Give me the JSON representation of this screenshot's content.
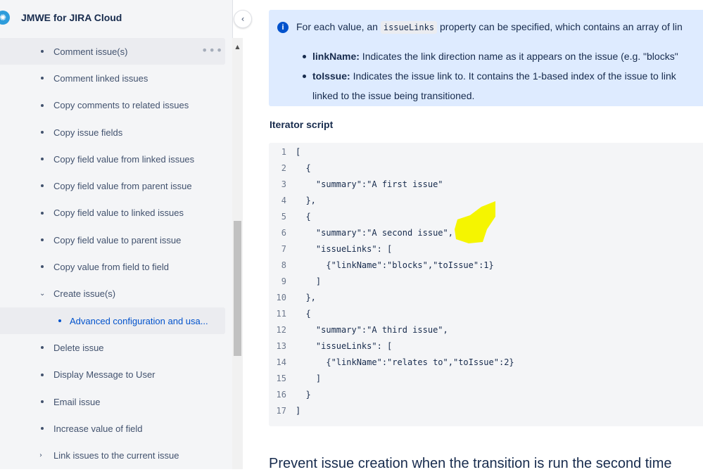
{
  "sidebar": {
    "title": "JMWE for JIRA Cloud",
    "collapse_icon": "‹",
    "more_icon": "•••",
    "items": [
      {
        "label": "Comment issue(s)",
        "type": "bullet",
        "highlight": true,
        "more": true
      },
      {
        "label": "Comment linked issues",
        "type": "bullet"
      },
      {
        "label": "Copy comments to related issues",
        "type": "bullet"
      },
      {
        "label": "Copy issue fields",
        "type": "bullet"
      },
      {
        "label": "Copy field value from linked issues",
        "type": "bullet"
      },
      {
        "label": "Copy field value from parent issue",
        "type": "bullet"
      },
      {
        "label": "Copy field value to linked issues",
        "type": "bullet"
      },
      {
        "label": "Copy field value to parent issue",
        "type": "bullet"
      },
      {
        "label": "Copy value from field to field",
        "type": "bullet"
      },
      {
        "label": "Create issue(s)",
        "type": "expanded",
        "chevron": "⌄"
      },
      {
        "label": "Advanced configuration and usa...",
        "type": "child",
        "highlight": true
      },
      {
        "label": "Delete issue",
        "type": "bullet"
      },
      {
        "label": "Display Message to User",
        "type": "bullet"
      },
      {
        "label": "Email issue",
        "type": "bullet"
      },
      {
        "label": "Increase value of field",
        "type": "bullet"
      },
      {
        "label": "Link issues to the current issue",
        "type": "collapsed",
        "chevron": "›"
      }
    ]
  },
  "info": {
    "icon": "i",
    "text_before": "For each value, an ",
    "code": "issueLinks",
    "text_after": " property can be specified, which contains an array of lin",
    "bullets": [
      {
        "term": "linkName:",
        "text": " Indicates the link direction name as it appears on the issue (e.g. \"blocks\""
      },
      {
        "term": "toIssue:",
        "text": " Indicates the issue link to. It contains the 1-based index of the issue to link",
        "cont": "linked to the issue being transitioned."
      }
    ]
  },
  "section_title": "Iterator script",
  "code_lines": [
    {
      "n": "1",
      "code": "["
    },
    {
      "n": "2",
      "code": "  {"
    },
    {
      "n": "3",
      "code": "    \"summary\":\"A first issue\""
    },
    {
      "n": "4",
      "code": "  },"
    },
    {
      "n": "5",
      "code": "  {"
    },
    {
      "n": "6",
      "code": "    \"summary\":\"A second issue\","
    },
    {
      "n": "7",
      "code": "    \"issueLinks\": ["
    },
    {
      "n": "8",
      "code": "      {\"linkName\":\"blocks\",\"toIssue\":1}"
    },
    {
      "n": "9",
      "code": "    ]"
    },
    {
      "n": "10",
      "code": "  },"
    },
    {
      "n": "11",
      "code": "  {"
    },
    {
      "n": "12",
      "code": "    \"summary\":\"A third issue\","
    },
    {
      "n": "13",
      "code": "    \"issueLinks\": ["
    },
    {
      "n": "14",
      "code": "      {\"linkName\":\"relates to\",\"toIssue\":2}"
    },
    {
      "n": "15",
      "code": "    ]"
    },
    {
      "n": "16",
      "code": "  }"
    },
    {
      "n": "17",
      "code": "]"
    }
  ],
  "bottom_heading": "Prevent issue creation when the transition is run the second time",
  "colors": {
    "accent": "#0052cc",
    "info_bg": "#deebff",
    "highlighter": "#f5f500"
  }
}
